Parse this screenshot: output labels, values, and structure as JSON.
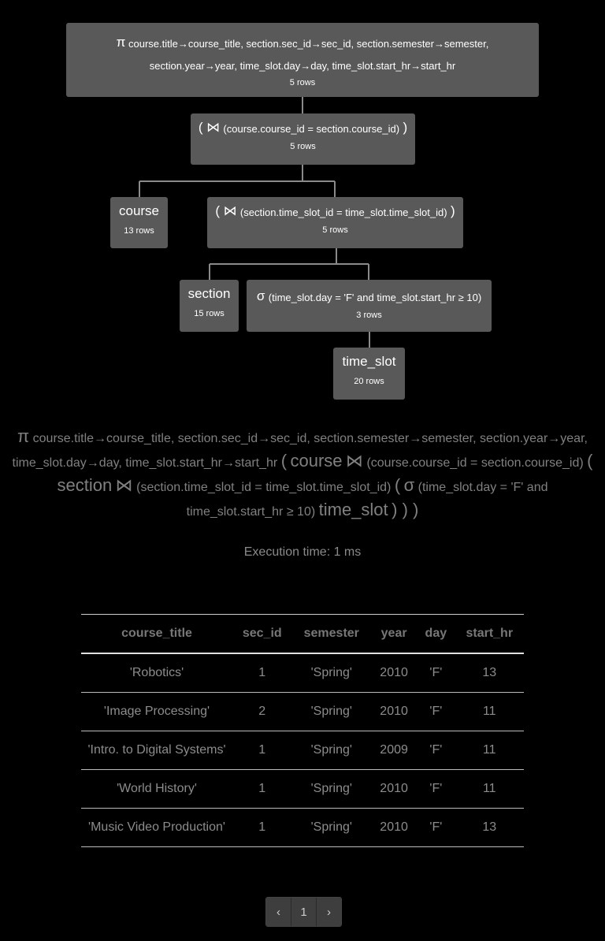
{
  "tree": {
    "project": {
      "symbol": "π",
      "line1": "course.title→course_title, section.sec_id→sec_id, section.semester→semester,",
      "line2": "section.year→year, time_slot.day→day, time_slot.start_hr→start_hr",
      "rows": "5 rows"
    },
    "join1": {
      "open": "(",
      "symbol": "⋈",
      "condition": "(course.course_id = section.course_id)",
      "close": ")",
      "rows": "5 rows"
    },
    "course": {
      "name": "course",
      "rows": "13 rows"
    },
    "join2": {
      "open": "(",
      "symbol": "⋈",
      "condition": "(section.time_slot_id = time_slot.time_slot_id)",
      "close": ")",
      "rows": "5 rows"
    },
    "section": {
      "name": "section",
      "rows": "15 rows"
    },
    "select": {
      "symbol": "σ",
      "condition": "(time_slot.day = 'F' and time_slot.start_hr ≥ 10)",
      "rows": "3 rows"
    },
    "time_slot": {
      "name": "time_slot",
      "rows": "20 rows"
    }
  },
  "expression": {
    "pi": "π",
    "projection": "course.title→course_title, section.sec_id→sec_id, section.semester→semester, section.year→year, time_slot.day→day, time_slot.start_hr→start_hr",
    "open1": "(",
    "rel_course": "course",
    "join_sym1": "⋈",
    "cond1": "(course.course_id = section.course_id)",
    "open2": "(",
    "rel_section": "section",
    "join_sym2": "⋈",
    "cond2": "(section.time_slot_id = time_slot.time_slot_id)",
    "open3": "(",
    "sigma": "σ",
    "cond3": "(time_slot.day = 'F' and time_slot.start_hr ≥ 10)",
    "rel_timeslot": "time_slot",
    "close": ") ) )"
  },
  "execution_time": "Execution time: 1 ms",
  "table": {
    "headers": [
      "course_title",
      "sec_id",
      "semester",
      "year",
      "day",
      "start_hr"
    ],
    "rows": [
      [
        "'Robotics'",
        "1",
        "'Spring'",
        "2010",
        "'F'",
        "13"
      ],
      [
        "'Image Processing'",
        "2",
        "'Spring'",
        "2010",
        "'F'",
        "11"
      ],
      [
        "'Intro. to Digital Systems'",
        "1",
        "'Spring'",
        "2009",
        "'F'",
        "11"
      ],
      [
        "'World History'",
        "1",
        "'Spring'",
        "2010",
        "'F'",
        "11"
      ],
      [
        "'Music Video Production'",
        "1",
        "'Spring'",
        "2010",
        "'F'",
        "13"
      ]
    ]
  },
  "pagination": {
    "prev": "‹",
    "page": "1",
    "next": "›"
  }
}
